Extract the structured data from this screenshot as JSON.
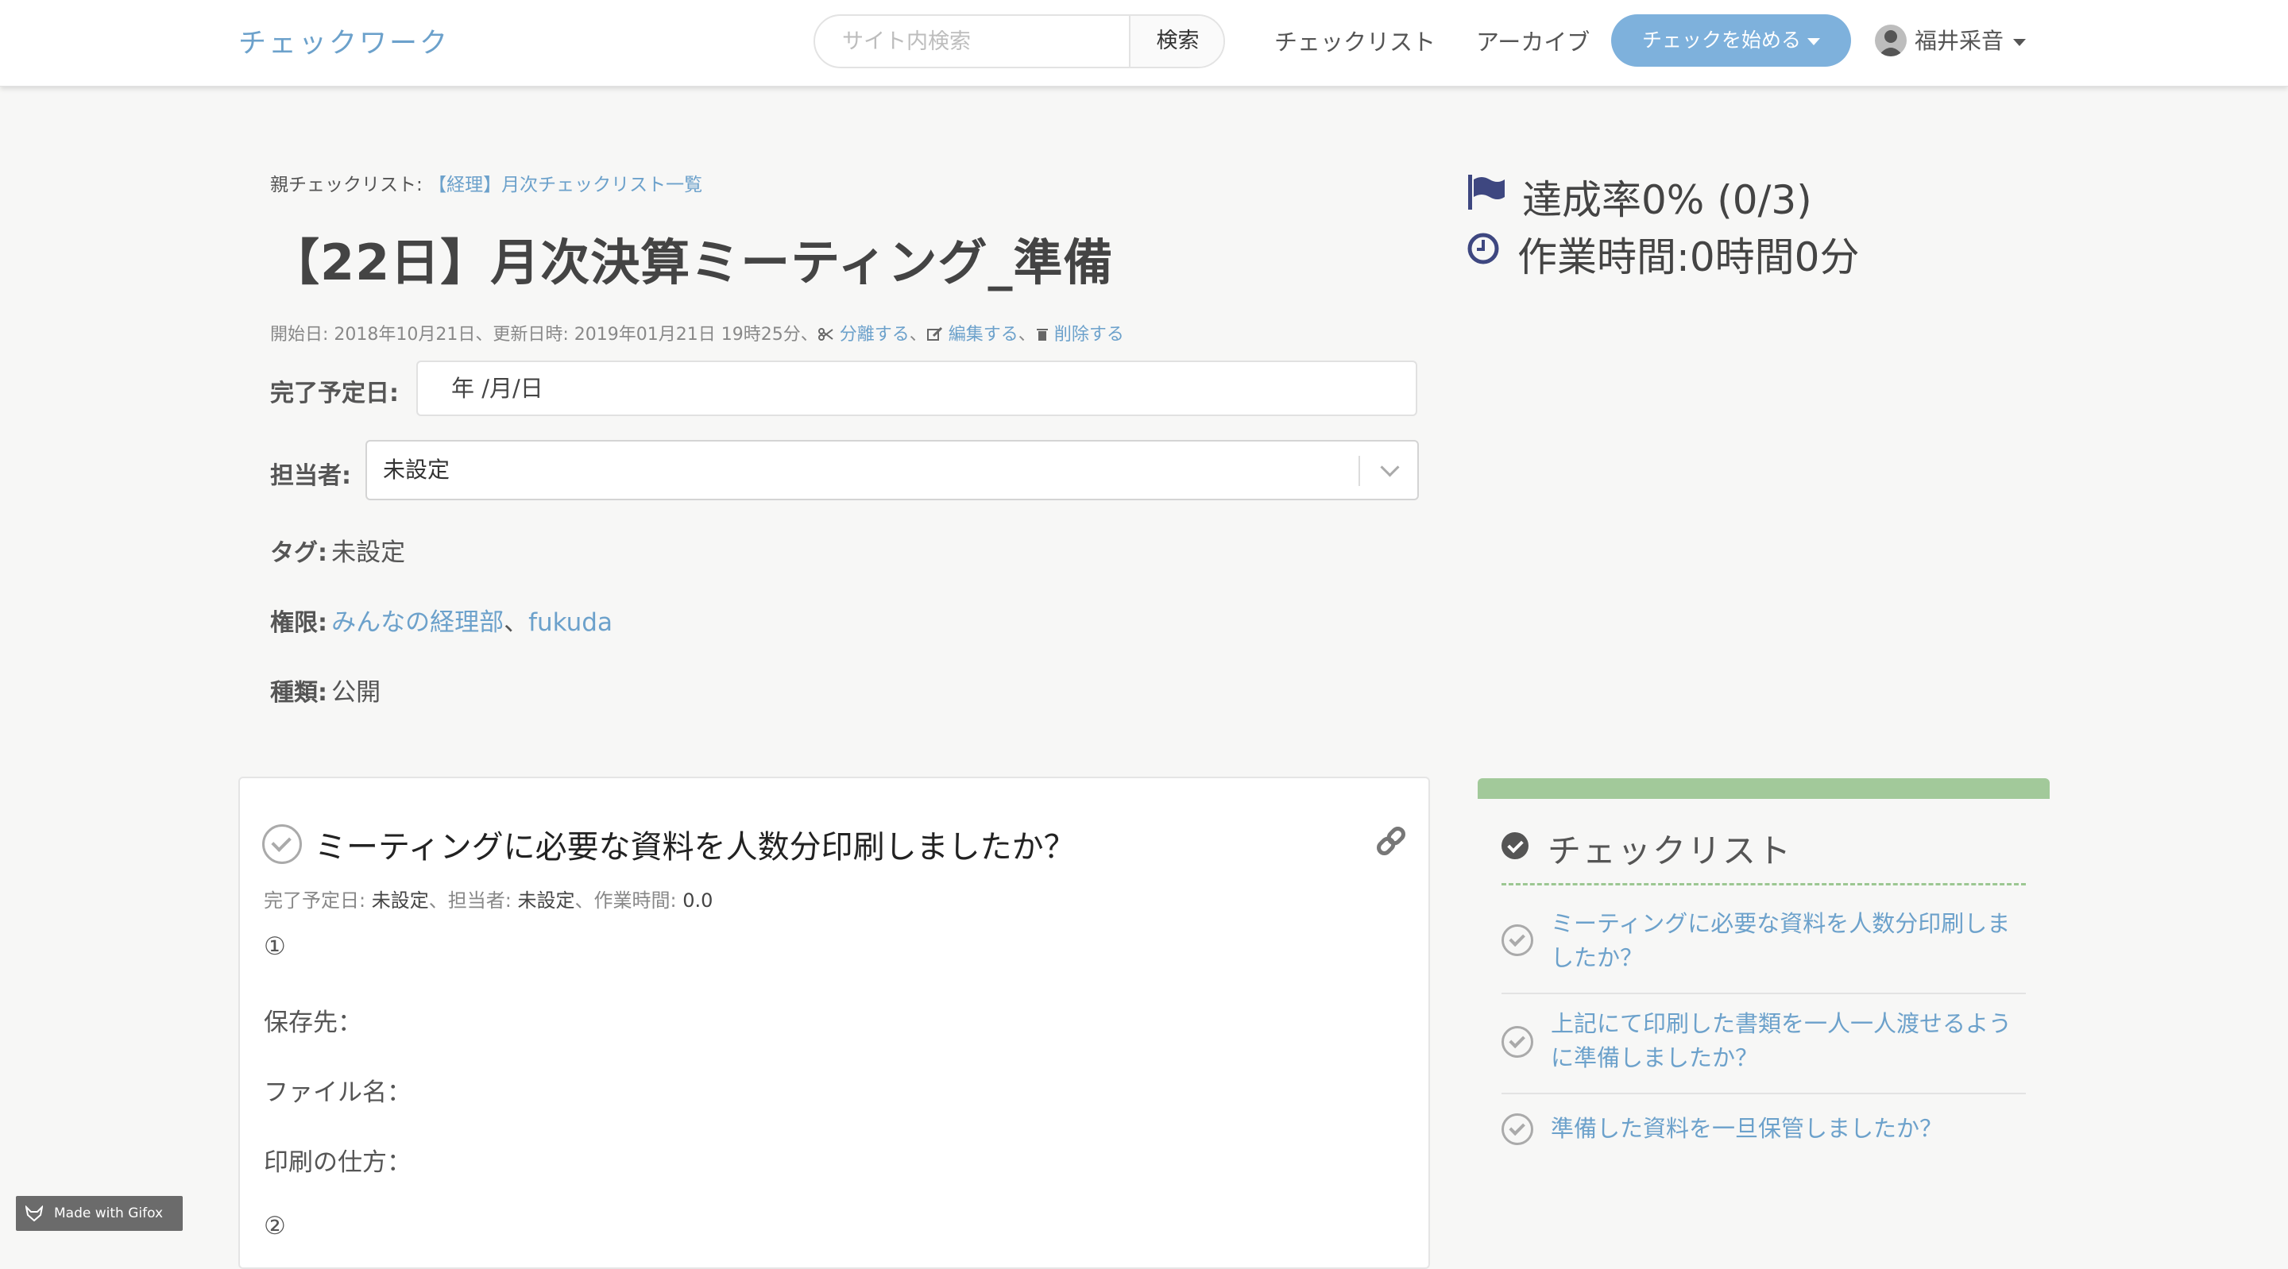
{
  "nav": {
    "brand": "チェックワーク",
    "search_placeholder": "サイト内検索",
    "search_button": "検索",
    "links": [
      "チェックリスト",
      "アーカイブ"
    ],
    "start_button": "チェックを始める",
    "user_name": "福井采音"
  },
  "checklist": {
    "parent_label": "親チェックリスト:",
    "parent_link": "【経理】月次チェックリスト一覧",
    "title": "【22日】月次決算ミーティング_準備",
    "meta_text": "開始日: 2018年10月21日、更新日時: 2019年01月21日 19時25分、",
    "actions": [
      "分離する",
      "編集する",
      "削除する"
    ],
    "due_label": "完了予定日:",
    "due_placeholder": "年 /月/日",
    "assignee_label": "担当者:",
    "assignee_value": "未設定",
    "tag_label": "タグ:",
    "tag_value": "未設定",
    "permission_label": "権限:",
    "permissions": [
      "みんなの経理部",
      "fukuda"
    ],
    "type_label": "種類:",
    "type_value": "公開"
  },
  "stats": {
    "achievement": "達成率0% (0/3)",
    "work_time": "作業時間:0時間0分"
  },
  "item": {
    "title": "ミーティングに必要な資料を人数分印刷しましたか？",
    "due_label": "完了予定日:",
    "due_value": "未設定",
    "assignee_label": "担当者:",
    "assignee_value": "未設定",
    "time_label": "作業時間:",
    "time_value": "0.0",
    "lines": [
      "①",
      "保存先：",
      "ファイル名：",
      "印刷の仕方：",
      "②"
    ]
  },
  "sidebar": {
    "title": "チェックリスト",
    "items": [
      "ミーティングに必要な資料を人数分印刷しましたか？",
      "上記にて印刷した書類を一人一人渡せるように準備しましたか？",
      "準備した資料を一旦保管しましたか？"
    ]
  },
  "badge": "Made with Gifox",
  "colors": {
    "accent": "#6ca1cb",
    "start_button": "#7eb1dc",
    "sidebar_bar": "#a2c99a",
    "flag": "#3e4780"
  },
  "icons": [
    "flag-icon",
    "clock-icon",
    "scissors-icon",
    "edit-icon",
    "trash-icon",
    "link-icon",
    "check-circle-icon",
    "gifox-icon"
  ]
}
